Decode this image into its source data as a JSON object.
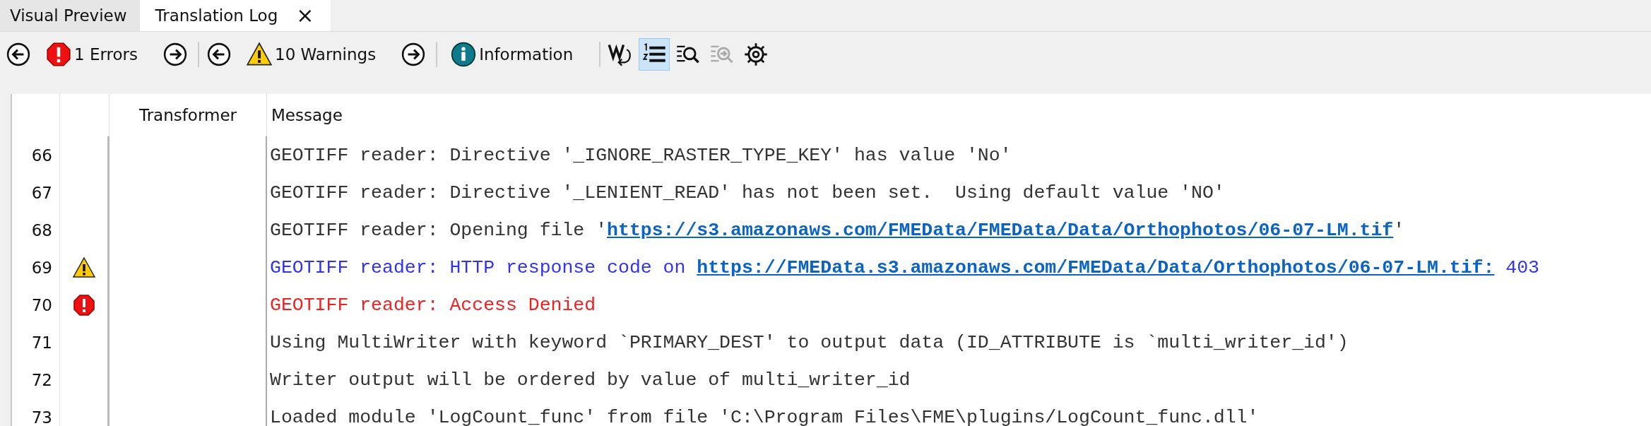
{
  "tabs": [
    {
      "label": "Visual Preview",
      "selected": false
    },
    {
      "label": "Translation Log",
      "selected": true,
      "close_glyph": "×"
    }
  ],
  "toolbar": {
    "errors": {
      "label": "1 Errors"
    },
    "warnings": {
      "label": "10 Warnings"
    },
    "information": {
      "label": "Information"
    },
    "tools": [
      {
        "kind": "wrap",
        "selected": false,
        "disabled": false
      },
      {
        "kind": "line-numbers",
        "selected": true,
        "disabled": false
      },
      {
        "kind": "find",
        "selected": false,
        "disabled": false
      },
      {
        "kind": "find-next",
        "selected": false,
        "disabled": true
      },
      {
        "kind": "settings",
        "selected": false,
        "disabled": false
      }
    ]
  },
  "table": {
    "columns": [
      "Transformer",
      "Message"
    ],
    "rows": [
      {
        "line": "66",
        "kind": "info",
        "message": [
          {
            "kind": "text",
            "text": "GEOTIFF reader: Directive '_IGNORE_RASTER_TYPE_KEY' has value 'No'"
          }
        ]
      },
      {
        "line": "67",
        "kind": "info",
        "message": [
          {
            "kind": "text",
            "text": "GEOTIFF reader: Directive '_LENIENT_READ' has not been set.  Using default value 'NO'"
          }
        ]
      },
      {
        "line": "68",
        "kind": "info",
        "message": [
          {
            "kind": "text",
            "text": "GEOTIFF reader: Opening file '"
          },
          {
            "kind": "link",
            "text": "https://s3.amazonaws.com/FMEData/FMEData/Data/Orthophotos/06-07-LM.tif"
          },
          {
            "kind": "text",
            "text": "'"
          }
        ]
      },
      {
        "line": "69",
        "kind": "warning",
        "message": [
          {
            "kind": "text",
            "text": "GEOTIFF reader: HTTP response code on "
          },
          {
            "kind": "link",
            "text": "https://FMEData.s3.amazonaws.com/FMEData/Data/Orthophotos/06-07-LM.tif:"
          },
          {
            "kind": "text",
            "text": " 403"
          }
        ]
      },
      {
        "line": "70",
        "kind": "error",
        "message": [
          {
            "kind": "text",
            "text": "GEOTIFF reader: Access Denied"
          }
        ]
      },
      {
        "line": "71",
        "kind": "info",
        "message": [
          {
            "kind": "text",
            "text": "Using MultiWriter with keyword `PRIMARY_DEST' to output data (ID_ATTRIBUTE is `multi_writer_id')"
          }
        ]
      },
      {
        "line": "72",
        "kind": "info",
        "message": [
          {
            "kind": "text",
            "text": "Writer output will be ordered by value of multi_writer_id"
          }
        ]
      },
      {
        "line": "73",
        "kind": "info",
        "message": [
          {
            "kind": "text",
            "text": "Loaded module 'LogCount_func' from file 'C:\\Program Files\\FME\\plugins/LogCount_func.dll'"
          }
        ]
      }
    ]
  }
}
